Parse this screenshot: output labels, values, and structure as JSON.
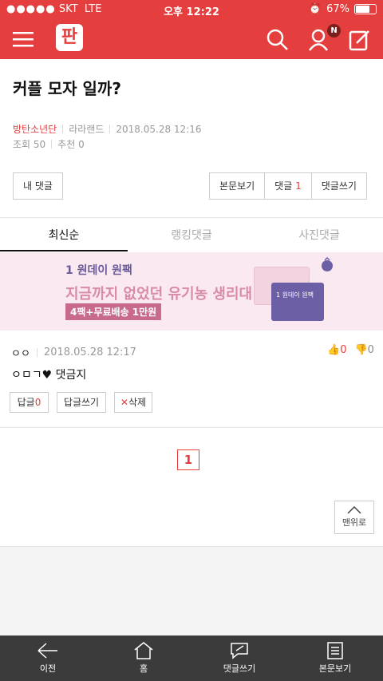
{
  "status": {
    "carrier": "SKT",
    "network": "LTE",
    "time": "오후 12:22",
    "battery": "67%"
  },
  "header": {
    "logo": "판",
    "notification_badge": "N"
  },
  "post": {
    "title": "커플 모자 일까?",
    "author": "방탄소년단",
    "category": "라라랜드",
    "date": "2018.05.28 12:16",
    "views_label": "조회 50",
    "recommend_label": "추천 0"
  },
  "actions": {
    "my_comments": "내 댓글",
    "view_post": "본문보기",
    "comments_label": "댓글",
    "comments_count": "1",
    "write_comment": "댓글쓰기"
  },
  "tabs": [
    "최신순",
    "랭킹댓글",
    "사진댓글"
  ],
  "banner": {
    "line1": "1 원데이 원팩",
    "line2": "지금까지 없었던 유기농 생리대",
    "line3": "4팩+무료배송 1만원",
    "pack_text": "1 원데이 원팩"
  },
  "comment": {
    "author": "ㅇㅇ",
    "date": "2018.05.28 12:17",
    "body": "ㅇㅁㄱ♥ 댓금지",
    "likes": "0",
    "dislikes": "0",
    "reply_label": "답글",
    "reply_count": "0",
    "write_reply": "답글쓰기",
    "delete": "삭제"
  },
  "pagination": {
    "current": "1"
  },
  "top_button": "맨위로",
  "bottom_nav": [
    "이전",
    "홈",
    "댓글쓰기",
    "본문보기"
  ],
  "colors": {
    "brand": "#e53e3e",
    "bottom_bar": "#3b3b3b"
  }
}
